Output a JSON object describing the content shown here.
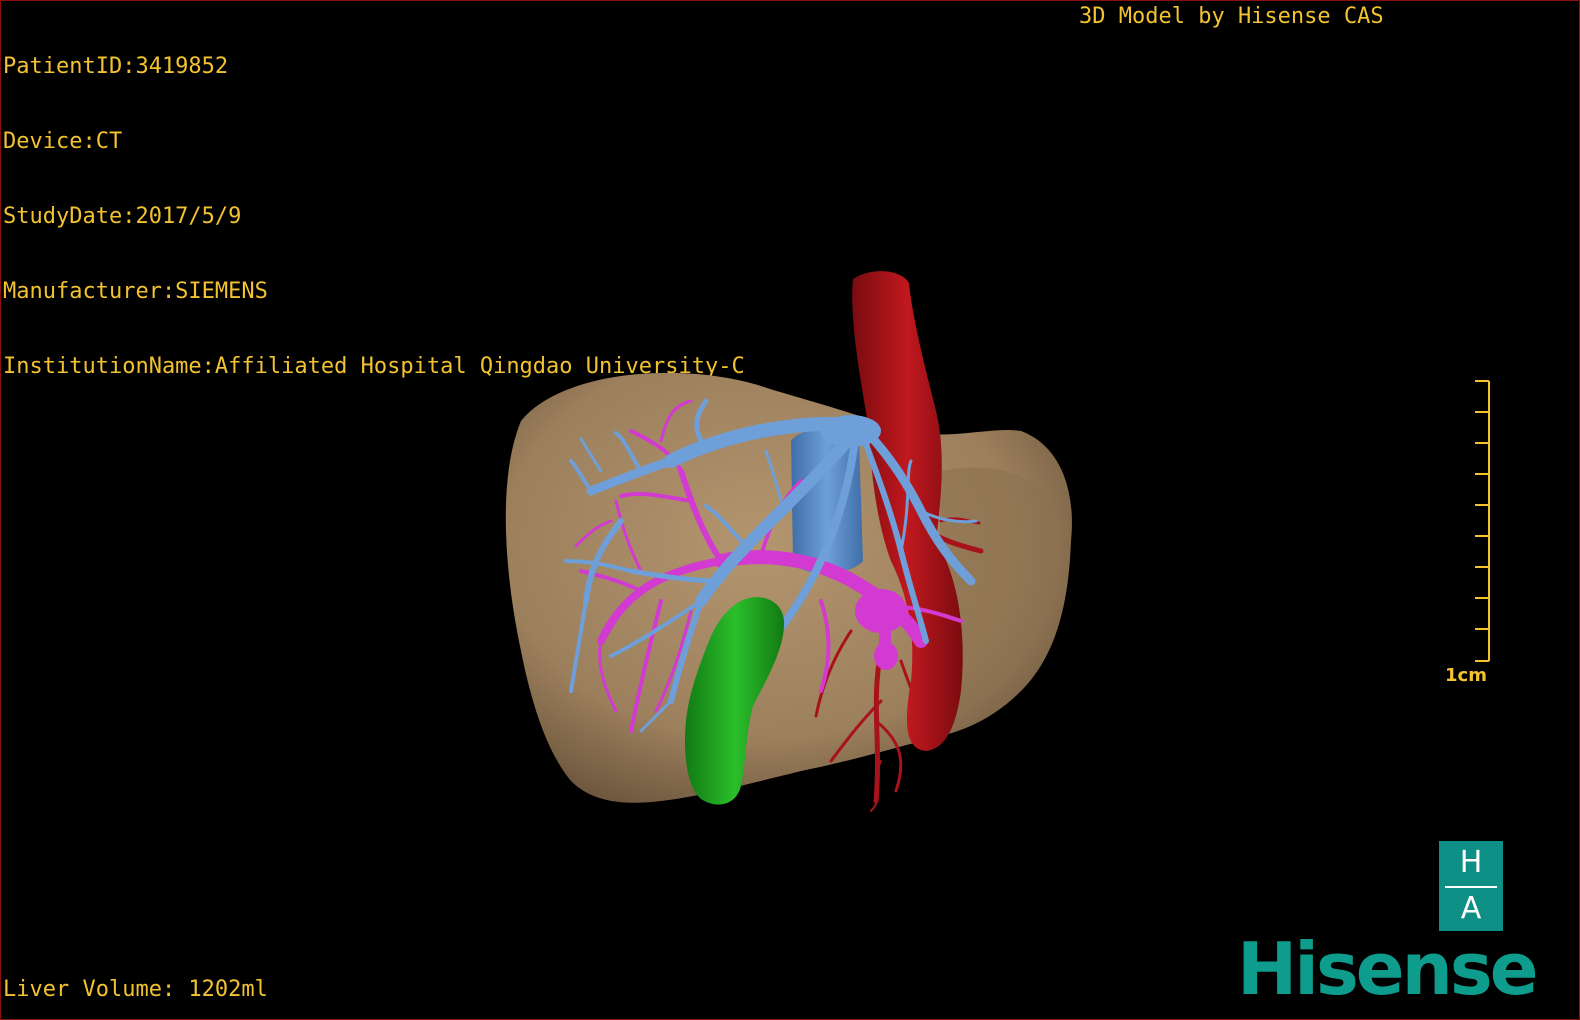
{
  "header": {
    "patient_id": "PatientID:3419852",
    "device": "Device:CT",
    "study_date": "StudyDate:2017/5/9",
    "manufacturer": "Manufacturer:SIEMENS",
    "institution": "InstitutionName:Affiliated Hospital Qingdao University-C",
    "model_credit": "3D Model by Hisense CAS"
  },
  "footer": {
    "liver_volume": "Liver Volume: 1202ml"
  },
  "scale": {
    "label": "1cm"
  },
  "branding": {
    "ha_top": "H",
    "ha_bottom": "A",
    "brand_name": "Hisense"
  },
  "colors": {
    "info_text": "#f2c230",
    "liver": "#a08360",
    "hepatic_vein": "#6f9fd8",
    "portal_vein": "#d23ad2",
    "artery_ivc": "#b0141a",
    "gallbladder": "#1fa01f",
    "brand": "#0e9c8c"
  },
  "structures": [
    "liver",
    "hepatic-vein",
    "portal-vein",
    "inferior-vena-cava",
    "hepatic-artery",
    "gallbladder"
  ]
}
